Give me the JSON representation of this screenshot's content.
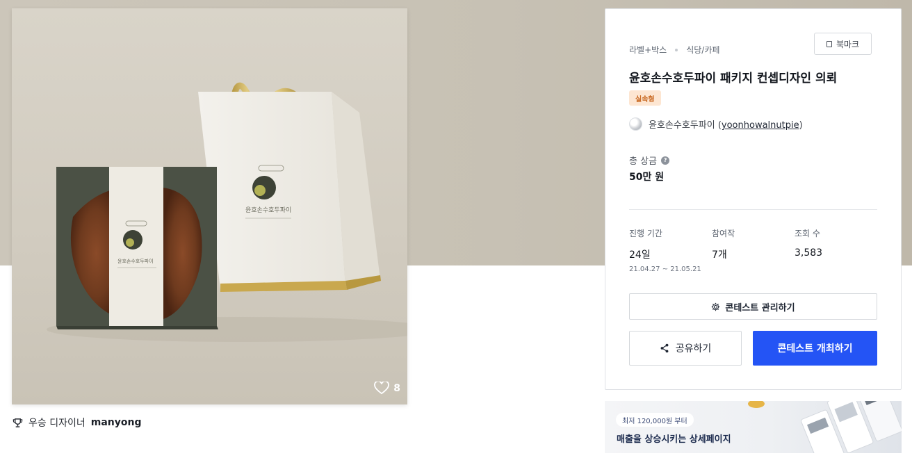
{
  "gallery": {
    "likes": "8",
    "winner_prefix": "우승 디자이너",
    "winner_name": "manyong"
  },
  "contest": {
    "category_primary": "라벨+박스",
    "category_secondary": "식당/카페",
    "bookmark_label": "북마크",
    "title": "윤호손수호두파이 패키지 컨셉디자인 의뢰",
    "badge": "실속형",
    "host_name": "윤호손수호두파이",
    "host_handle": "yoonhowalnutpie",
    "prize_label": "총 상금",
    "prize_value": "50만 원",
    "stats": {
      "period_label": "진행 기간",
      "period_value": "24일",
      "period_dates": "21.04.27 ~ 21.05.21",
      "entries_label": "참여작",
      "entries_value": "7개",
      "views_label": "조회 수",
      "views_value": "3,583"
    },
    "manage_label": "콘테스트 관리하기",
    "share_label": "공유하기",
    "host_button_label": "콘테스트 개최하기"
  },
  "ad": {
    "price_pill": "최저 120,000원 부터",
    "headline": "매출을 상승시키는 상세페이지"
  },
  "colors": {
    "primary": "#2454f5",
    "badge_bg": "#fde6d2",
    "badge_text": "#c8671f",
    "hero_band": "#c9c3b6"
  },
  "icons": [
    "heart-icon",
    "trophy-icon",
    "bookmark-icon",
    "help-icon",
    "gear-icon",
    "share-icon"
  ]
}
